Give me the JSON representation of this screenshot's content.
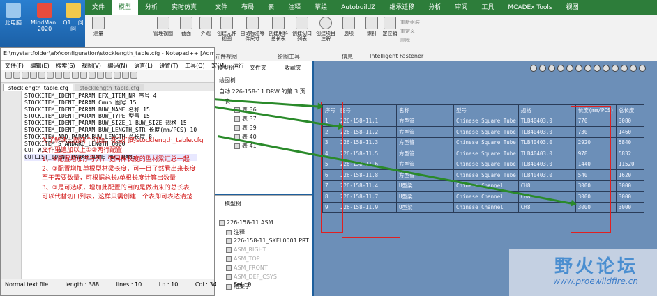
{
  "desktop": {
    "icons": [
      {
        "label": "此电脑"
      },
      {
        "label": "MindMan... 2020"
      },
      {
        "label": "Q1... 问问"
      }
    ]
  },
  "notepad": {
    "title": "E:\\mystartfolder\\afx\\configuration\\stocklength_table.cfg - Notepad++ [Adm",
    "menu": [
      "文件(F)",
      "编辑(E)",
      "搜索(S)",
      "视图(V)",
      "编码(N)",
      "语言(L)",
      "设置(T)",
      "工具(O)",
      "宏(M)",
      "运行"
    ],
    "tabs": [
      "stocklength_table.cfg",
      "stocklength_table.cfg"
    ],
    "code_lines": [
      "STOCKITEM_IDENT_PARAM EFX_ITEM_NR 序号 4",
      "STOCKITEM_IDENT_PARAM Cmun 图号 15",
      "STOCKITEM_IDENT_PARAM BUW_NAME 名称 15",
      "STOCKITEM_IDENT_PARAM BUW_TYPE 型号 15",
      "STOCKITEM_IDENT_PARAM BUW_SIZE_1 BUW_SIZE 规格 15",
      "STOCKITEM_IDENT_PARAM BUW_LENGTH_STR 长度(mm/PCS) 10",
      "STOCKITEM_ADD_PARAM BUW_LENGTH 总长度 8",
      "STOCKITEM_STANDARD_LENGTH 6000",
      "CUT_WIDTH 5",
      "CUTLIST_IDENT_PARAM_NAME MDL_NAME"
    ],
    "notes": [
      "为了解决上图两个问题，在我们的stocklength_table.cfg",
      "文件里追加以上①②两行配置",
      "1、①配置增加序号列，使同样长度的型材梁汇总一起",
      "2、②配置增加单根型材梁长度，可一目了然看出来长度",
      "至于需要数量，可根据总长/单根长度计算出数量",
      "3、③是可选项，增加此配置的目的是做出来的总长表",
      "可以代替切口列表，这样只需创建一个表即可表达清楚"
    ],
    "status": {
      "type": "Normal text file",
      "length": "length : 388",
      "lines": "lines : 10",
      "ln": "Ln : 10",
      "col": "Col : 34",
      "sel": "Sel : 0"
    }
  },
  "creo": {
    "tabs": [
      "文件",
      "模型",
      "分析",
      "实时仿真",
      "文件",
      "布局",
      "表",
      "注释",
      "草绘",
      "AutobuildZ",
      "继承迁移",
      "分析",
      "审阅",
      "工具",
      "MCADEx Tools",
      "视图"
    ],
    "active_tab_index": 1,
    "left_ribbon": [
      {
        "label": "测量"
      },
      {
        "label": "管理视图"
      },
      {
        "label": "截面"
      },
      {
        "label": "外观"
      }
    ],
    "ribbon_buttons": [
      {
        "label": "创建元件视图"
      },
      {
        "label": "自动标注零件尺寸"
      },
      {
        "label": "创建用料总长表"
      },
      {
        "label": "创建切口列表"
      },
      {
        "label": "创建项目注解"
      },
      {
        "label": "选项"
      },
      {
        "label": "螺钉"
      },
      {
        "label": "定位销"
      },
      {
        "label": "重新组装"
      },
      {
        "label": "重定义"
      },
      {
        "label": "删除"
      }
    ],
    "ribbon_groups": [
      "元件视图",
      "绘图工具",
      "信息",
      "Intelligent Fastener"
    ],
    "tree_top": {
      "tabs": [
        "模型树",
        "文件夹",
        "收藏夹"
      ],
      "header": "绘图树",
      "sheet": "自动 226-158-11.DRW 的第 3 页",
      "node": "表",
      "items": [
        "表 36",
        "表 37",
        "表 39",
        "表 40",
        "表 41"
      ]
    },
    "tree_bot": {
      "header": "模型树",
      "items": [
        "226-158-11.ASM",
        "注释",
        "226-158-11_SKEL0001.PRT",
        "ASM_RIGHT",
        "ASM_TOP",
        "ASM_FRONT",
        "ASM_DEF_CSYS",
        "结架子"
      ]
    }
  },
  "table": {
    "headers": [
      "序号",
      "图号",
      "名称",
      "型号",
      "规格",
      "长度(mm/PCS)",
      "总长度"
    ],
    "rows": [
      [
        "1",
        "226-158-11.1",
        "方型管",
        "Chinese Square Tube",
        "TLB40403.0",
        "770",
        "3080"
      ],
      [
        "2",
        "226-158-11.2",
        "方型管",
        "Chinese Square Tube",
        "TLB40403.0",
        "730",
        "1460"
      ],
      [
        "3",
        "226-158-11.3",
        "方型管",
        "Chinese Square Tube",
        "TLB40403.0",
        "2920",
        "5840"
      ],
      [
        "4",
        "226-158-11.5",
        "方型管",
        "Chinese Square Tube",
        "TLB40403.0",
        "978",
        "5832"
      ],
      [
        "5",
        "226-158-11.6",
        "方型管",
        "Chinese Square Tube",
        "TLB40403.0",
        "1440",
        "11520"
      ],
      [
        "6",
        "226-158-11.8",
        "方型管",
        "Chinese Square Tube",
        "TLB40403.0",
        "540",
        "1620"
      ],
      [
        "7",
        "226-158-11.4",
        "U型梁",
        "Chinese Channel",
        "CH8",
        "3000",
        "3000"
      ],
      [
        "8",
        "226-158-11.7",
        "U型梁",
        "Chinese Channel",
        "CH8",
        "3000",
        "3000"
      ],
      [
        "9",
        "226-158-11.9",
        "U型梁",
        "Chinese Channel",
        "CH8",
        "3000",
        "3000"
      ]
    ]
  },
  "markers": [
    "1",
    "3",
    "2"
  ],
  "watermark": {
    "title": "野火论坛",
    "url": "www.proewildfire.cn"
  }
}
